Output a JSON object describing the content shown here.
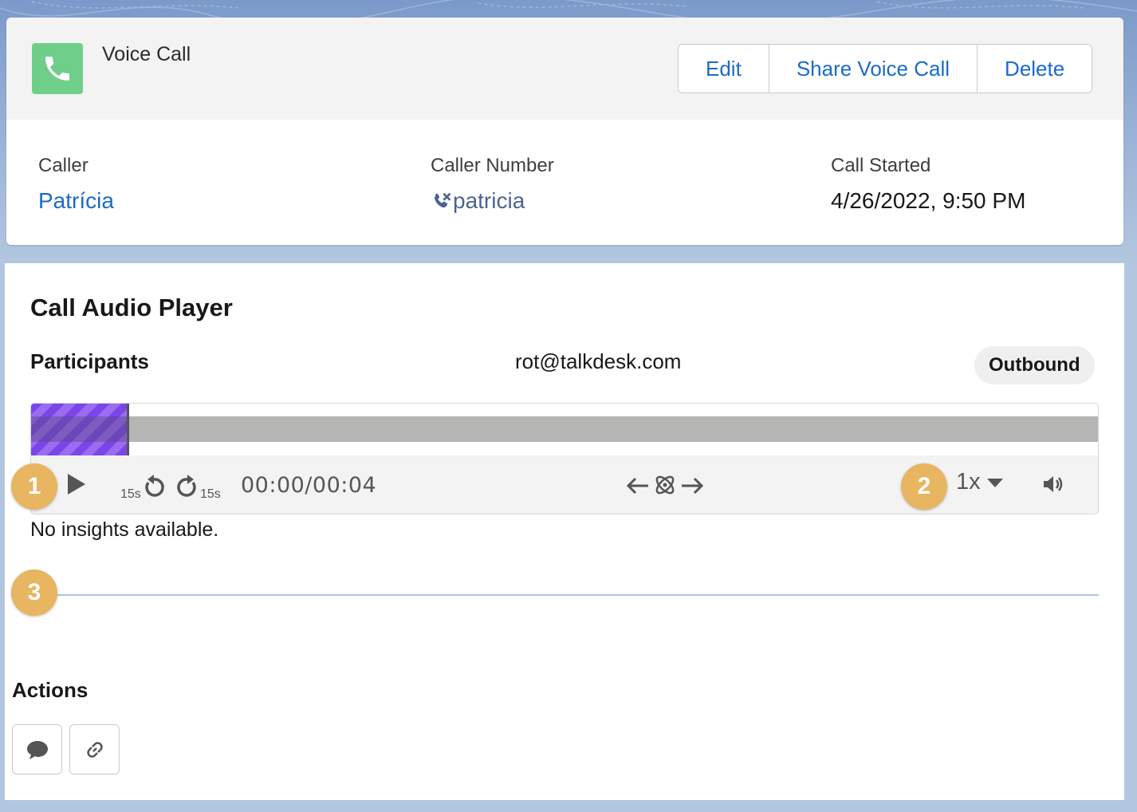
{
  "record": {
    "title": "Voice Call",
    "icon": "phone-icon",
    "buttons": {
      "edit": "Edit",
      "share": "Share Voice Call",
      "delete": "Delete"
    },
    "fields": {
      "caller_label": "Caller",
      "caller_value": "Patrícia",
      "caller_number_label": "Caller Number",
      "caller_number_value": "patricia",
      "call_started_label": "Call Started",
      "call_started_value": "4/26/2022, 9:50 PM"
    }
  },
  "player": {
    "title": "Call Audio Player",
    "participants_label": "Participants",
    "participant_email": "rot@talkdesk.com",
    "direction_badge": "Outbound",
    "progress_fraction": 0.09,
    "skip_back_label": "15s",
    "skip_forward_label": "15s",
    "time": "00:00/00:04",
    "speed": "1x",
    "insights_text": "No insights available.",
    "colors": {
      "progress": "#7c45e8",
      "track": "#b5b5b3",
      "marker": "#e8b560"
    }
  },
  "markers": {
    "one": "1",
    "two": "2",
    "three": "3"
  },
  "actions": {
    "title": "Actions",
    "items": [
      {
        "icon": "comment-icon"
      },
      {
        "icon": "link-icon"
      }
    ]
  }
}
